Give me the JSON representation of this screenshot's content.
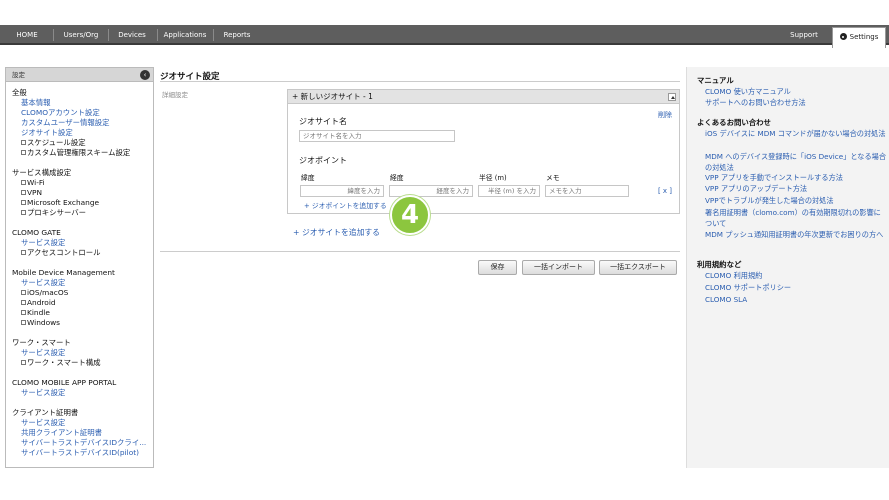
{
  "nav": {
    "items": [
      "HOME",
      "Users/Org",
      "Devices",
      "Applications",
      "Reports"
    ],
    "support": "Support",
    "settings": "Settings"
  },
  "sidebar": {
    "header": "設定",
    "sections": [
      {
        "title": "全般",
        "items": [
          {
            "label": "基本情報",
            "type": "link"
          },
          {
            "label": "CLOMOアカウント設定",
            "type": "link"
          },
          {
            "label": "カスタムユーザー情報設定",
            "type": "link"
          },
          {
            "label": "ジオサイト設定",
            "type": "link"
          },
          {
            "label": "スケジュール設定",
            "type": "tree"
          },
          {
            "label": "カスタム管理権限スキーム設定",
            "type": "tree"
          }
        ]
      },
      {
        "title": "サービス構成設定",
        "items": [
          {
            "label": "Wi-Fi",
            "type": "tree"
          },
          {
            "label": "VPN",
            "type": "tree"
          },
          {
            "label": "Microsoft Exchange",
            "type": "tree"
          },
          {
            "label": "プロキシサーバー",
            "type": "tree"
          }
        ]
      },
      {
        "title": "CLOMO GATE",
        "items": [
          {
            "label": "サービス設定",
            "type": "link"
          },
          {
            "label": "アクセスコントロール",
            "type": "tree"
          }
        ]
      },
      {
        "title": "Mobile Device Management",
        "items": [
          {
            "label": "サービス設定",
            "type": "link"
          },
          {
            "label": "iOS/macOS",
            "type": "tree"
          },
          {
            "label": "Android",
            "type": "tree"
          },
          {
            "label": "Kindle",
            "type": "tree"
          },
          {
            "label": "Windows",
            "type": "tree"
          }
        ]
      },
      {
        "title": "ワーク・スマート",
        "items": [
          {
            "label": "サービス設定",
            "type": "link"
          },
          {
            "label": "ワーク・スマート構成",
            "type": "tree"
          }
        ]
      },
      {
        "title": "CLOMO MOBILE APP PORTAL",
        "items": [
          {
            "label": "サービス設定",
            "type": "link"
          }
        ]
      },
      {
        "title": "クライアント証明書",
        "items": [
          {
            "label": "サービス設定",
            "type": "link"
          },
          {
            "label": "共用クライアント証明書",
            "type": "link"
          },
          {
            "label": "サイバートラストデバイスIDクライ...",
            "type": "link"
          },
          {
            "label": "サイバートラストデバイスID(pilot)",
            "type": "link"
          }
        ]
      }
    ]
  },
  "main": {
    "title": "ジオサイト設定",
    "detail_label": "詳細設定",
    "panel_title": "+ 新しいジオサイト - 1",
    "delete": "削除",
    "site_name_label": "ジオサイト名",
    "site_name_placeholder": "ジオサイト名を入力",
    "geopoint_label": "ジオポイント",
    "columns": [
      "緯度",
      "経度",
      "半径 (m)",
      "メモ"
    ],
    "placeholders": [
      "緯度を入力",
      "経度を入力",
      "半径 (m) を入力",
      "メモを入力"
    ],
    "remove": "[ x ]",
    "add_point": "+ ジオポイントを追加する",
    "add_site": "+ ジオサイトを追加する",
    "buttons": {
      "save": "保存",
      "import": "一括インポート",
      "export": "一括エクスポート"
    },
    "badge": "4"
  },
  "right": {
    "manual_title": "マニュアル",
    "manual_links": [
      "CLOMO 使い方マニュアル",
      "サポートへのお問い合わせ方法"
    ],
    "faq_title": "よくあるお問い合わせ",
    "faq_links": [
      "iOS デバイスに MDM コマンドが届かない場合の対処法",
      "MDM へのデバイス登録時に「iOS Device」となる場合の対処法",
      "VPP アプリを手動でインストールする方法",
      "VPP アプリのアップデート方法",
      "VPPでトラブルが発生した場合の対処法",
      "署名用証明書（clomo.com）の有効期限切れの影響について",
      "MDM プッシュ通知用証明書の年次更新でお困りの方へ"
    ],
    "terms_title": "利用規約など",
    "terms_links": [
      "CLOMO 利用規約",
      "CLOMO サポートポリシー",
      "CLOMO SLA"
    ]
  }
}
